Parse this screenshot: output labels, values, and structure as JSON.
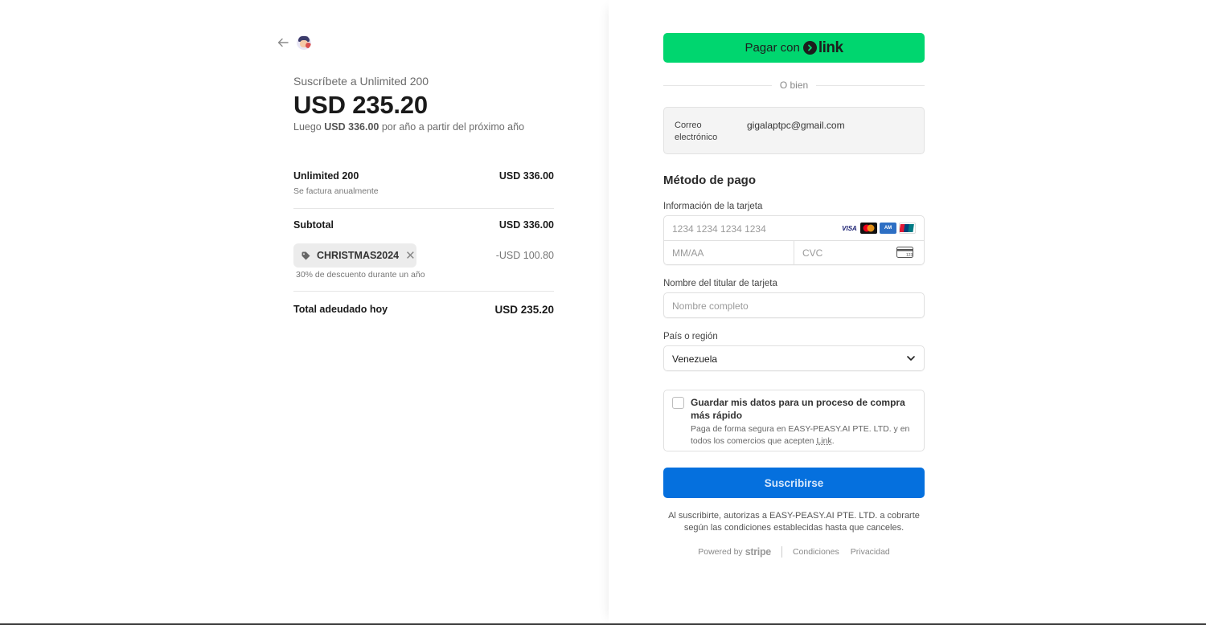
{
  "summary": {
    "back_icon": "arrow-left-icon",
    "subscribe_title": "Suscríbete a Unlimited 200",
    "big_price": "USD 235.20",
    "then_prefix": "Luego",
    "then_amount": "USD 336.00",
    "then_suffix": "por año a partir del próximo año",
    "item_name": "Unlimited 200",
    "item_price": "USD 336.00",
    "item_billing": "Se factura anualmente",
    "subtotal_label": "Subtotal",
    "subtotal_amount": "USD 336.00",
    "promo_code": "CHRISTMAS2024",
    "discount_amount": "-USD 100.80",
    "discount_note": "30% de descuento durante un año",
    "total_label": "Total adeudado hoy",
    "total_amount": "USD 235.20"
  },
  "checkout": {
    "link_button_prefix": "Pagar con",
    "link_word": "link",
    "or_text": "O bien",
    "email_label": "Correo electrónico",
    "email_value": "gigalaptpc@gmail.com",
    "payment_title": "Método de pago",
    "card_info_label": "Información de la tarjeta",
    "card_number_placeholder": "1234 1234 1234 1234",
    "card_brands": [
      "VISA",
      "mastercard",
      "amex",
      "unionpay"
    ],
    "expiry_placeholder": "MM/AA",
    "cvc_placeholder": "CVC",
    "cardholder_label": "Nombre del titular de tarjeta",
    "cardholder_placeholder": "Nombre completo",
    "country_label": "País o región",
    "country_value": "Venezuela",
    "save_title": "Guardar mis datos para un proceso de compra más rápido",
    "save_desc_main": "Paga de forma segura en EASY-PEASY.AI PTE. LTD. y en todos los comercios que acepten ",
    "save_desc_link": "Link",
    "save_desc_end": ".",
    "subscribe_label": "Suscribirse",
    "legal_text": "Al suscribirte, autorizas a EASY-PEASY.AI PTE. LTD. a cobrarte según las condiciones establecidas hasta que canceles.",
    "powered_by": "Powered by",
    "stripe_word": "stripe",
    "terms_link": "Condiciones",
    "privacy_link": "Privacidad"
  },
  "colors": {
    "link_green": "#00d66f",
    "subscribe_blue": "#0570de"
  }
}
